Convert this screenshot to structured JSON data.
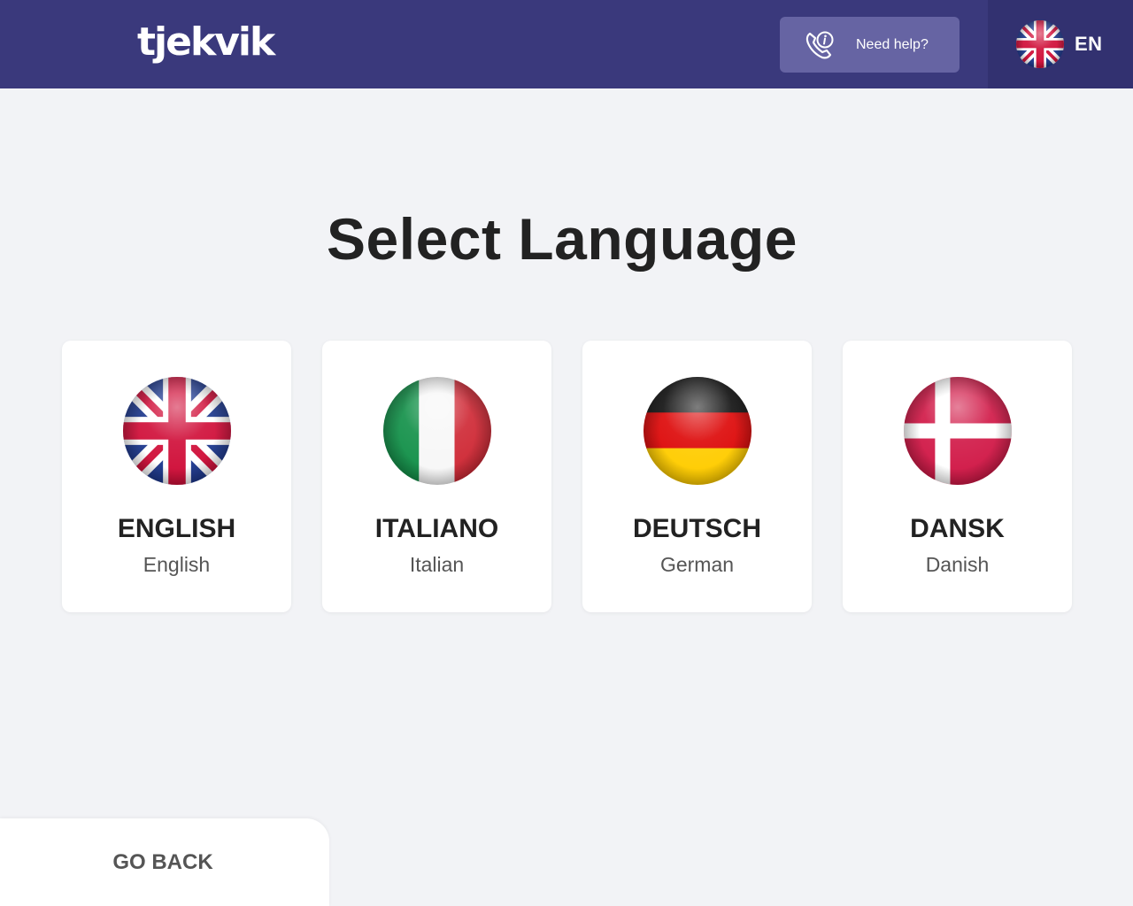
{
  "header": {
    "logo": "tjekvik",
    "help_button": {
      "label": "Need help?",
      "icon": "phone-info-icon"
    },
    "language_switch": {
      "code": "EN",
      "icon": "uk-flag-icon"
    },
    "colors": {
      "background": "#3a397c",
      "help_button": "#6664a3",
      "language_switch": "#323170"
    }
  },
  "main": {
    "title": "Select Language",
    "languages": [
      {
        "native": "ENGLISH",
        "english": "English",
        "icon": "uk-flag-icon"
      },
      {
        "native": "ITALIANO",
        "english": "Italian",
        "icon": "italy-flag-icon"
      },
      {
        "native": "DEUTSCH",
        "english": "German",
        "icon": "germany-flag-icon"
      },
      {
        "native": "DANSK",
        "english": "Danish",
        "icon": "denmark-flag-icon"
      }
    ]
  },
  "footer": {
    "back_label": "GO BACK"
  },
  "colors": {
    "page_background": "#f2f3f6",
    "card_background": "#ffffff",
    "text": "#222222",
    "muted_text": "#555555"
  }
}
